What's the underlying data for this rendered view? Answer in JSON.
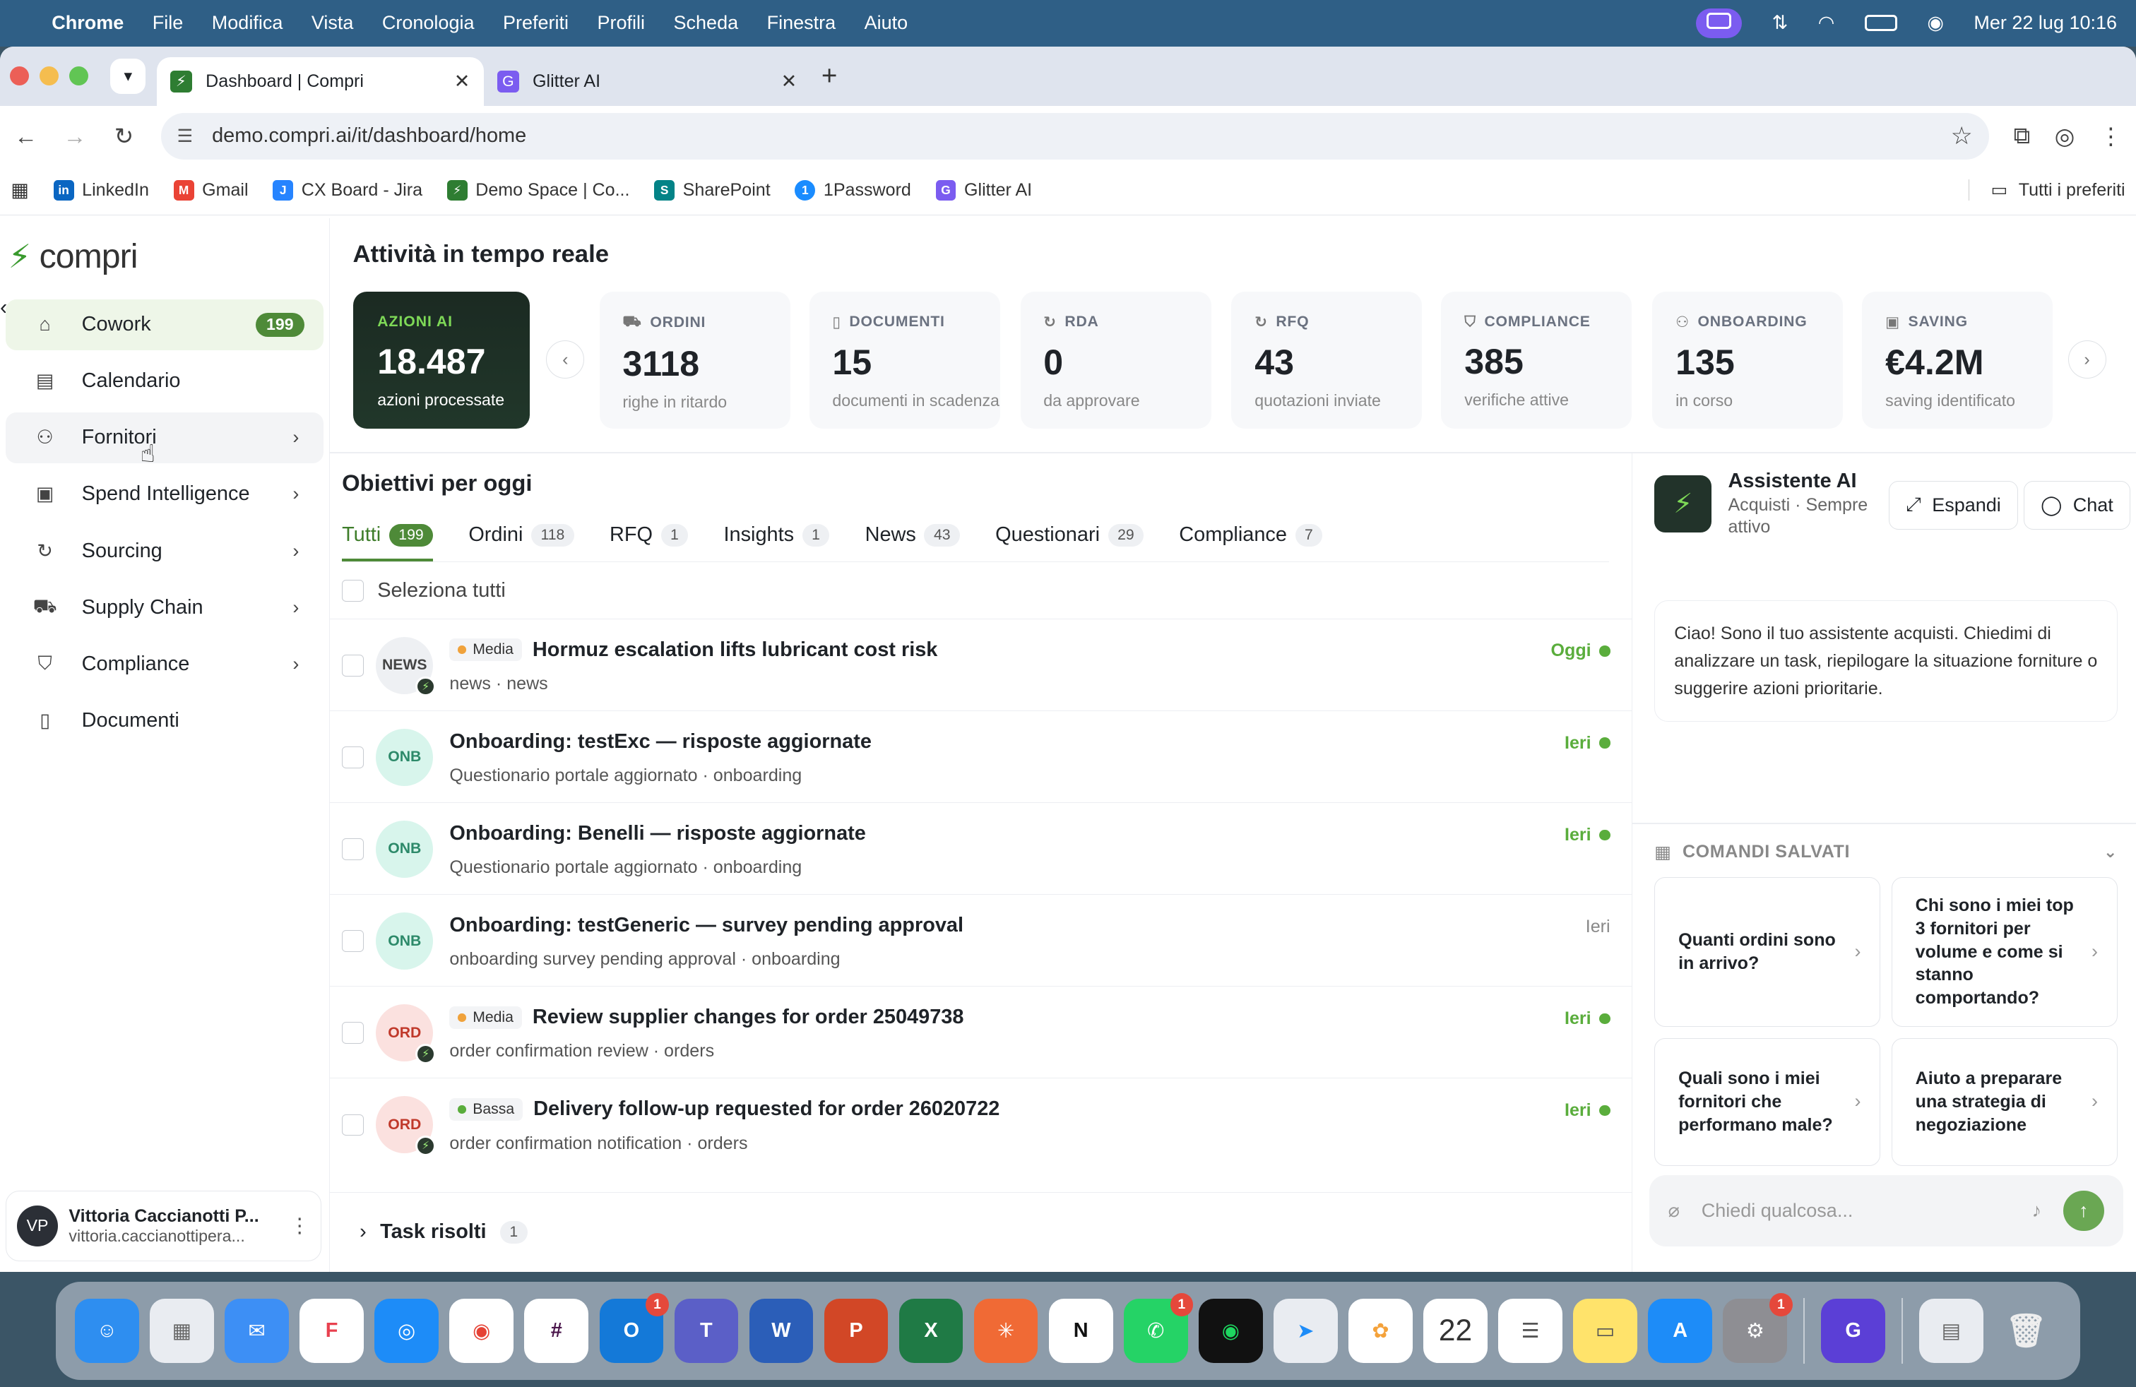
{
  "menubar": {
    "app": "Chrome",
    "items": [
      "File",
      "Modifica",
      "Vista",
      "Cronologia",
      "Preferiti",
      "Profili",
      "Scheda",
      "Finestra",
      "Aiuto"
    ],
    "datetime": "Mer 22 lug  10:16"
  },
  "browser": {
    "tabs": [
      {
        "title": "Dashboard | Compri",
        "active": true
      },
      {
        "title": "Glitter AI",
        "active": false
      }
    ],
    "url": "demo.compri.ai/it/dashboard/home",
    "bookmarks": [
      "LinkedIn",
      "Gmail",
      "CX Board - Jira",
      "Demo Space | Co...",
      "SharePoint",
      "1Password",
      "Glitter AI"
    ],
    "all_bookmarks": "Tutti i preferiti"
  },
  "sidebar": {
    "brand": "compri",
    "items": [
      {
        "label": "Cowork",
        "icon": "home-icon",
        "badge": "199",
        "active": true
      },
      {
        "label": "Calendario",
        "icon": "calendar-icon"
      },
      {
        "label": "Fornitori",
        "icon": "suppliers-icon",
        "chevron": true
      },
      {
        "label": "Spend Intelligence",
        "icon": "chart-icon",
        "chevron": true
      },
      {
        "label": "Sourcing",
        "icon": "sourcing-icon",
        "chevron": true
      },
      {
        "label": "Supply Chain",
        "icon": "truck-icon",
        "chevron": true
      },
      {
        "label": "Compliance",
        "icon": "shield-icon",
        "chevron": true
      },
      {
        "label": "Documenti",
        "icon": "document-icon"
      }
    ],
    "user": {
      "initials": "VP",
      "name": "Vittoria Caccianotti P...",
      "email": "vittoria.caccianottipera..."
    }
  },
  "realtime": {
    "title": "Attività in tempo reale",
    "ai": {
      "label": "AZIONI AI",
      "value": "18.487",
      "sub": "azioni processate"
    },
    "cards": [
      {
        "label": "ORDINI",
        "value": "3118",
        "sub": "righe in ritardo",
        "icon": "truck-icon"
      },
      {
        "label": "DOCUMENTI",
        "value": "15",
        "sub": "documenti in scadenza",
        "icon": "document-icon"
      },
      {
        "label": "RDA",
        "value": "0",
        "sub": "da approvare",
        "icon": "refresh-icon"
      },
      {
        "label": "RFQ",
        "value": "43",
        "sub": "quotazioni inviate",
        "icon": "refresh-icon"
      },
      {
        "label": "COMPLIANCE",
        "value": "385",
        "sub": "verifiche attive",
        "icon": "shield-icon"
      },
      {
        "label": "ONBOARDING",
        "value": "135",
        "sub": "in corso",
        "icon": "user-icon"
      },
      {
        "label": "SAVING",
        "value": "€4.2M",
        "sub": "saving identificato",
        "icon": "wallet-icon"
      }
    ]
  },
  "objectives": {
    "title": "Obiettivi per oggi",
    "tabs": [
      {
        "label": "Tutti",
        "count": "199",
        "active": true
      },
      {
        "label": "Ordini",
        "count": "118"
      },
      {
        "label": "RFQ",
        "count": "1"
      },
      {
        "label": "Insights",
        "count": "1"
      },
      {
        "label": "News",
        "count": "43"
      },
      {
        "label": "Questionari",
        "count": "29"
      },
      {
        "label": "Compliance",
        "count": "7"
      }
    ],
    "select_all": "Seleziona tutti",
    "tasks": [
      {
        "tag": "NEWS",
        "priority": "Media",
        "title": "Hormuz escalation lifts lubricant cost risk",
        "meta": "news · news",
        "when": "Oggi",
        "dot": true
      },
      {
        "tag": "ONB",
        "priority": "",
        "title": "Onboarding: testExc — risposte aggiornate",
        "meta": "Questionario portale aggiornato · onboarding",
        "when": "Ieri",
        "dot": true
      },
      {
        "tag": "ONB",
        "priority": "",
        "title": "Onboarding: Benelli — risposte aggiornate",
        "meta": "Questionario portale aggiornato · onboarding",
        "when": "Ieri",
        "dot": true
      },
      {
        "tag": "ONB",
        "priority": "",
        "title": "Onboarding: testGeneric — survey pending approval",
        "meta": "onboarding survey pending approval · onboarding",
        "when": "Ieri",
        "dot": false
      },
      {
        "tag": "ORD",
        "priority": "Media",
        "title": "Review supplier changes for order 25049738",
        "meta": "order confirmation review · orders",
        "when": "Ieri",
        "dot": true
      },
      {
        "tag": "ORD",
        "priority": "Bassa",
        "title": "Delivery follow-up requested for order 26020722",
        "meta": "order confirmation notification · orders",
        "when": "Ieri",
        "dot": true
      }
    ],
    "resolved": {
      "label": "Task risolti",
      "count": "1"
    }
  },
  "assistant": {
    "name": "Assistente AI",
    "subtitle": "Acquisti · Sempre attivo",
    "expand": "Espandi",
    "chat": "Chat",
    "message": "Ciao! Sono il tuo assistente acquisti. Chiedimi di analizzare un task, riepilogare la situazione forniture o suggerire azioni prioritarie.",
    "saved_title": "COMANDI SALVATI",
    "commands": [
      "Quanti ordini sono in arrivo?",
      "Chi sono i miei top 3 fornitori per volume e come si stanno comportando?",
      "Quali sono i miei fornitori che performano male?",
      "Aiuto a preparare una strategia di negoziazione"
    ],
    "input_placeholder": "Chiedi qualcosa..."
  },
  "dock": {
    "calendar_day": "22",
    "badges": {
      "outlook": "1",
      "whatsapp": "1",
      "settings": "1"
    }
  },
  "colors": {
    "brand_green": "#4e8a38",
    "dark_card": "#1b2a22",
    "accent_lime": "#7ed957"
  }
}
